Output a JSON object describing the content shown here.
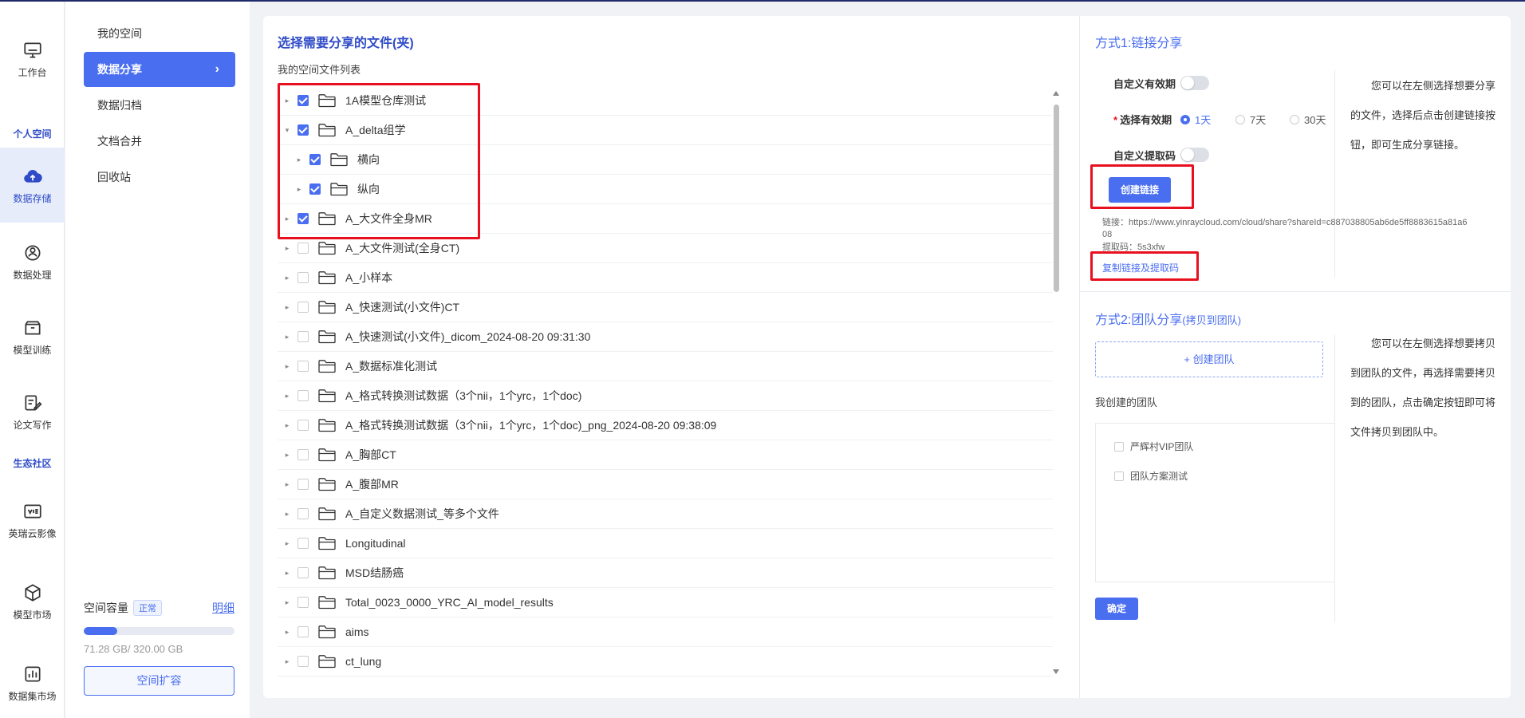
{
  "rail": {
    "items": [
      {
        "label": "工作台",
        "icon": "monitor-icon"
      },
      {
        "label": "数据存储",
        "icon": "cloud-upload-icon"
      },
      {
        "label": "数据处理",
        "icon": "process-icon"
      },
      {
        "label": "模型训练",
        "icon": "box-icon"
      },
      {
        "label": "论文写作",
        "icon": "edit-doc-icon"
      },
      {
        "label": "英瑞云影像",
        "icon": "image-viewer-icon"
      },
      {
        "label": "模型市场",
        "icon": "cube-icon"
      },
      {
        "label": "数据集市场",
        "icon": "bar-chart-icon"
      }
    ],
    "sections": [
      "个人空间",
      "生态社区"
    ]
  },
  "menu": {
    "items": [
      "我的空间",
      "数据分享",
      "数据归档",
      "文档合并",
      "回收站"
    ],
    "chevron": "›"
  },
  "storage": {
    "label": "空间容量",
    "status": "正常",
    "detail": "明细",
    "used_fraction": 0.2228,
    "size": "71.28 GB/ 320.00 GB",
    "expand": "空间扩容"
  },
  "main": {
    "title": "选择需要分享的文件(夹)",
    "list_label": "我的空间文件列表",
    "files": [
      {
        "name": "1A模型仓库测试",
        "checked": true,
        "expanded": false,
        "child": false
      },
      {
        "name": "A_delta组学",
        "checked": true,
        "expanded": true,
        "child": false
      },
      {
        "name": "横向",
        "checked": true,
        "expanded": false,
        "child": true
      },
      {
        "name": "纵向",
        "checked": true,
        "expanded": false,
        "child": true
      },
      {
        "name": "A_大文件全身MR",
        "checked": true,
        "expanded": false,
        "child": false
      },
      {
        "name": "A_大文件测试(全身CT)",
        "checked": false,
        "expanded": false,
        "child": false
      },
      {
        "name": "A_小样本",
        "checked": false,
        "expanded": false,
        "child": false
      },
      {
        "name": "A_快速测试(小文件)CT",
        "checked": false,
        "expanded": false,
        "child": false
      },
      {
        "name": "A_快速测试(小文件)_dicom_2024-08-20 09:31:30",
        "checked": false,
        "expanded": false,
        "child": false
      },
      {
        "name": "A_数据标准化测试",
        "checked": false,
        "expanded": false,
        "child": false
      },
      {
        "name": "A_格式转换测试数据（3个nii，1个yrc，1个doc)",
        "checked": false,
        "expanded": false,
        "child": false
      },
      {
        "name": "A_格式转换测试数据（3个nii，1个yrc，1个doc)_png_2024-08-20 09:38:09",
        "checked": false,
        "expanded": false,
        "child": false
      },
      {
        "name": "A_胸部CT",
        "checked": false,
        "expanded": false,
        "child": false
      },
      {
        "name": "A_腹部MR",
        "checked": false,
        "expanded": false,
        "child": false
      },
      {
        "name": "A_自定义数据测试_等多个文件",
        "checked": false,
        "expanded": false,
        "child": false
      },
      {
        "name": "Longitudinal",
        "checked": false,
        "expanded": false,
        "child": false
      },
      {
        "name": "MSD结肠癌",
        "checked": false,
        "expanded": false,
        "child": false
      },
      {
        "name": "Total_0023_0000_YRC_AI_model_results",
        "checked": false,
        "expanded": false,
        "child": false
      },
      {
        "name": "aims",
        "checked": false,
        "expanded": false,
        "child": false
      },
      {
        "name": "ct_lung",
        "checked": false,
        "expanded": false,
        "child": false
      }
    ]
  },
  "link_share": {
    "title": "方式1:链接分享",
    "custom_validity": "自定义有效期",
    "select_validity": "选择有效期",
    "required_mark": "*",
    "options": [
      "1天",
      "7天",
      "30天"
    ],
    "selected_option": "1天",
    "custom_code": "自定义提取码",
    "create_button": "创建链接",
    "link_line1": "链接：https://www.yinraycloud.com/cloud/share?shareId=c887038805ab6de5ff8883615a81a6",
    "link_line2": "08",
    "code_line": "提取码：5s3xfw",
    "copy_button": "复制链接及提取码",
    "help_lines": [
      "您可以在左侧选择想要分享",
      "的文件，选择后点击创建链接按",
      "钮，即可生成分享链接。"
    ]
  },
  "team_share": {
    "title": "方式2:团队分享",
    "title_suffix": "(拷贝到团队)",
    "create_team": "+ 创建团队",
    "my_teams_label": "我创建的团队",
    "teams": [
      "严辉村VIP团队",
      "团队方案测试"
    ],
    "confirm": "确定",
    "help_lines": [
      "您可以在左侧选择想要拷贝",
      "到团队的文件，再选择需要拷贝",
      "到的团队，点击确定按钮即可将",
      "文件拷贝到团队中。"
    ]
  },
  "colors": {
    "accent": "#4a6ef0",
    "highlight_box": "#e8101e",
    "title": "#2f4bc7"
  }
}
